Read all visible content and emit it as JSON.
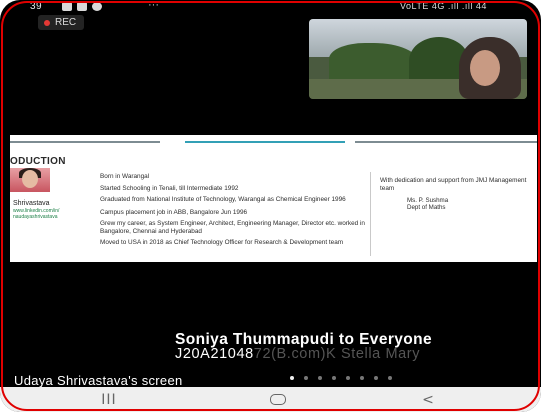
{
  "status_bar": {
    "time": "39",
    "more": "···",
    "network": "VoLTE 4G .ıll .ıll 44",
    "icons": [
      "message-icon",
      "gallery-icon",
      "whatsapp-icon"
    ]
  },
  "recording": {
    "label": "REC",
    "color": "#e53935"
  },
  "shared_slide": {
    "section_title": "ODUCTION",
    "presenter_name": "Shrivastava",
    "presenter_link": "www.linkedin.com/in/\nnaudayashrivastava",
    "bullets": [
      "Born in Warangal",
      "Started Schooling in Tenali, till Intermediate 1992",
      "Graduated from National Institute of Technology, Warangal as Chemical Engineer 1996",
      "Campus placement job in ABB, Bangalore Jun 1996",
      "Grew my career, as System Engineer, Architect, Engineering Manager, Director etc. worked in Bangalore, Chennai and Hyderabad",
      "Moved to USA in 2018 as Chief Technology Officer for Research & Development team"
    ],
    "acknowledgement": "With dedication and support from JMJ Management team",
    "signature_name": "Ms. P. Sushma",
    "signature_dept": "Dept of Maths"
  },
  "chat": {
    "line1": "Soniya Thummapudi to Everyone",
    "line2_main": "J20A21048",
    "line2_dim": "72(B.com)K Stella Mary"
  },
  "share_label": "Udaya Shrivastava's screen",
  "page_indicator": {
    "count": 8,
    "active": 0
  },
  "nav": {
    "recent": "III",
    "back": "<"
  },
  "colors": {
    "accent": "#33a0b6",
    "rec": "#e53935",
    "frame_border": "#e00000"
  }
}
